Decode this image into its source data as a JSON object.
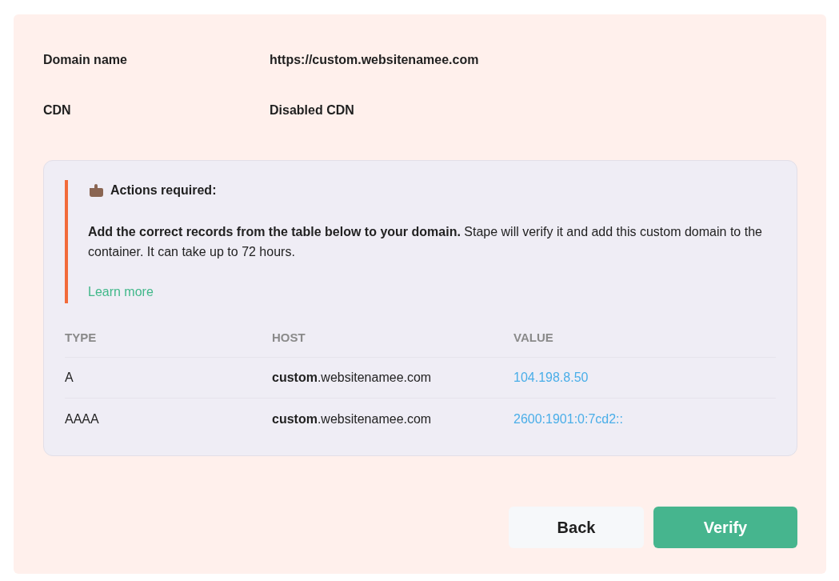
{
  "details": [
    {
      "label": "Domain name",
      "value": "https://custom.websitenamee.com"
    },
    {
      "label": "CDN",
      "value": "Disabled CDN"
    }
  ],
  "notice": {
    "title": "Actions required:",
    "message": "**Add the correct records from the table below to your domain.** Stape will verify it and add this custom domain to the container. It can take up to 72 hours.",
    "link": "Learn more"
  },
  "table": {
    "columns": [
      "TYPE",
      "HOST",
      "VALUE"
    ],
    "rows": [
      {
        "type": "A",
        "host": "**custom**.websitenamee.com",
        "value": "104.198.8.50"
      },
      {
        "type": "AAAA",
        "host": "**custom**.websitenamee.com",
        "value": "2600:1901:0:7cd2::"
      }
    ]
  },
  "buttons": [
    {
      "label": "Back",
      "kind": "secondary"
    },
    {
      "label": "Verify",
      "kind": "primary"
    }
  ]
}
